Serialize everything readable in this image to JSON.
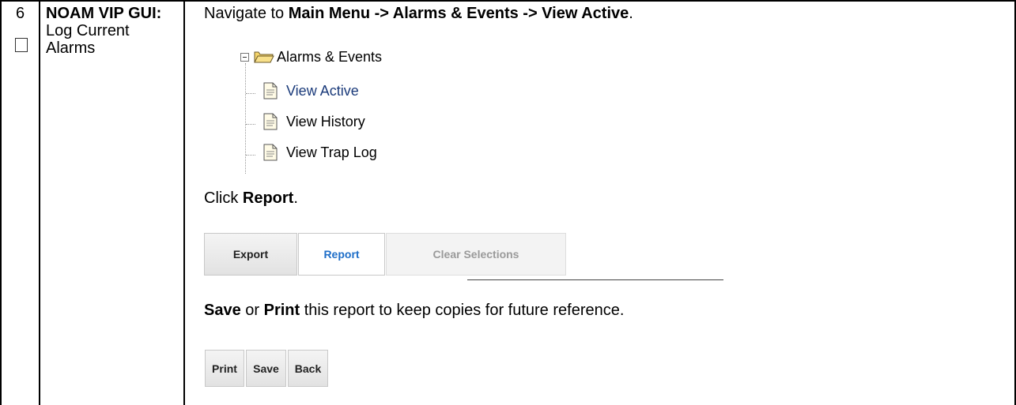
{
  "step": {
    "number": "6",
    "title_bold": "NOAM VIP GUI:",
    "title_rest": "Log Current Alarms"
  },
  "instructions": {
    "navigate_prefix": "Navigate to ",
    "navigate_path": "Main Menu -> Alarms & Events -> View Active",
    "navigate_suffix": ".",
    "click_prefix": "Click ",
    "click_target": "Report",
    "click_suffix": ".",
    "save_word": "Save",
    "or_word": " or ",
    "print_word": "Print",
    "save_suffix": " this report to keep copies for future reference."
  },
  "tree": {
    "root": {
      "label": "Alarms & Events",
      "icon": "folder-open-icon"
    },
    "children": [
      {
        "label": "View Active",
        "icon": "document-icon"
      },
      {
        "label": "View History",
        "icon": "document-icon"
      },
      {
        "label": "View Trap Log",
        "icon": "document-icon"
      }
    ]
  },
  "toolbar1": {
    "export_label": "Export",
    "report_label": "Report",
    "clear_label": "Clear Selections"
  },
  "toolbar2": {
    "print_label": "Print",
    "save_label": "Save",
    "back_label": "Back"
  }
}
